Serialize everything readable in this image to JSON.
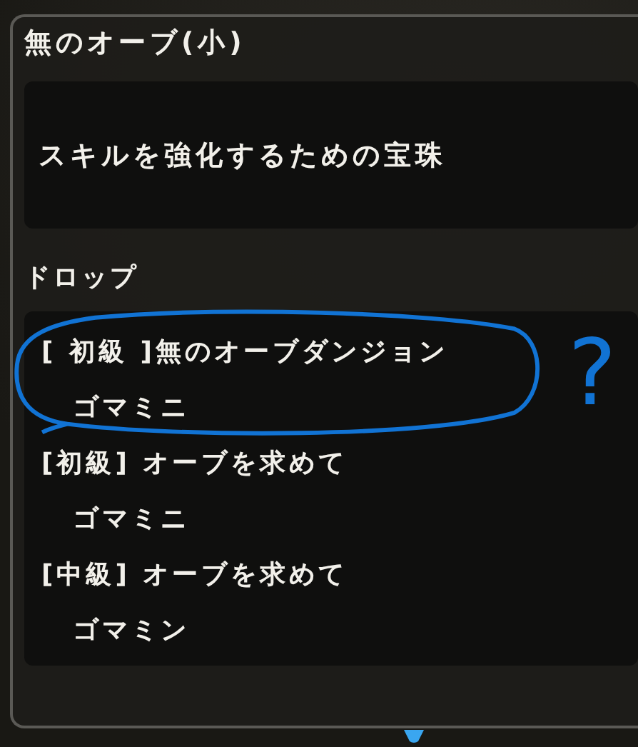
{
  "item": {
    "name": "無のオーブ(小)",
    "description": "スキルを強化するための宝珠"
  },
  "drop_section": {
    "heading": "ドロップ",
    "entries": [
      {
        "source": "[ 初級 ]無のオーブダンジョン",
        "monster": "ゴマミニ"
      },
      {
        "source": "[初級] オーブを求めて",
        "monster": "ゴマミニ"
      },
      {
        "source": "[中級] オーブを求めて",
        "monster": "ゴマミン"
      }
    ]
  },
  "annotation": {
    "mark": "?"
  }
}
